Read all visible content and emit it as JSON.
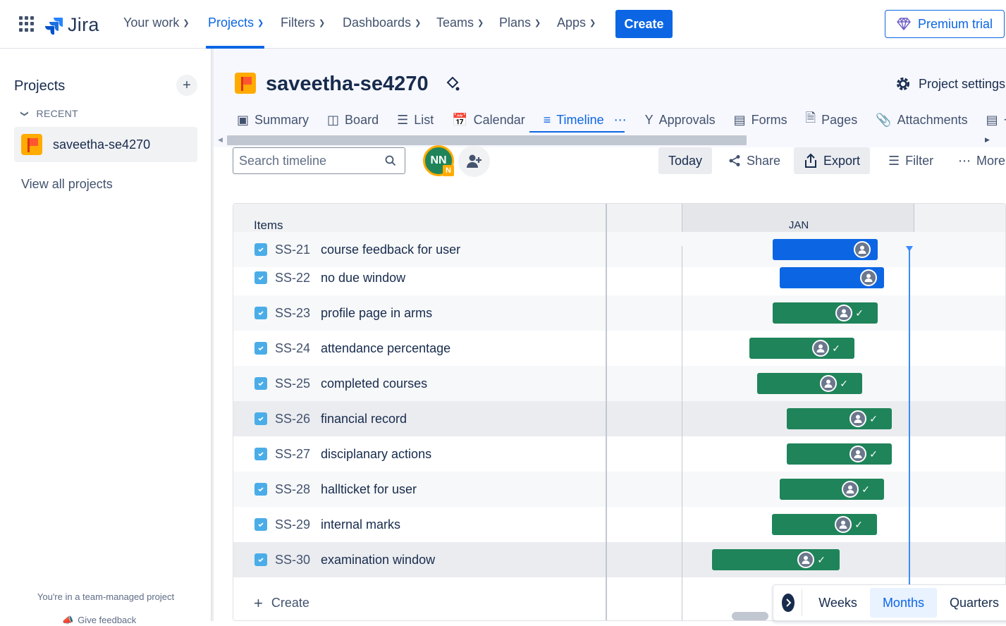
{
  "topnav": {
    "logo_text": "Jira",
    "items": [
      {
        "label": "Your work"
      },
      {
        "label": "Projects"
      },
      {
        "label": "Filters"
      },
      {
        "label": "Dashboards"
      },
      {
        "label": "Teams"
      },
      {
        "label": "Plans"
      },
      {
        "label": "Apps"
      }
    ],
    "active_item": "Projects",
    "create_label": "Create",
    "premium_label": "Premium trial",
    "accent": "#0c66e4"
  },
  "sidebar": {
    "title": "Projects",
    "recent_label": "RECENT",
    "project_name": "saveetha-se4270",
    "view_all": "View all projects",
    "footer_text": "You're in a team-managed project",
    "footer_link": "Give feedback"
  },
  "project": {
    "title": "saveetha-se4270",
    "settings_label": "Project settings",
    "tabs": [
      {
        "label": "Summary",
        "icon": "summary-icon"
      },
      {
        "label": "Board",
        "icon": "board-icon"
      },
      {
        "label": "List",
        "icon": "list-icon"
      },
      {
        "label": "Calendar",
        "icon": "calendar-icon"
      },
      {
        "label": "Timeline",
        "icon": "timeline-icon"
      },
      {
        "label": "Approvals",
        "icon": "approvals-icon"
      },
      {
        "label": "Forms",
        "icon": "forms-icon"
      },
      {
        "label": "Pages",
        "icon": "pages-icon"
      },
      {
        "label": "Attachments",
        "icon": "attachments-icon"
      }
    ],
    "active_tab": "Timeline"
  },
  "toolbar": {
    "search_placeholder": "Search timeline",
    "avatar_initials": "NN",
    "avatar_badge": "N",
    "today_label": "Today",
    "share_label": "Share",
    "export_label": "Export",
    "filter_label": "Filter",
    "more_label": "More"
  },
  "timeline": {
    "items_header": "Items",
    "month_label": "JAN",
    "create_label": "Create",
    "rows": [
      {
        "key": "SS-21",
        "summary": "course feedback for user",
        "status": "in-progress",
        "done": false
      },
      {
        "key": "SS-22",
        "summary": "no due window",
        "status": "in-progress",
        "done": false
      },
      {
        "key": "SS-23",
        "summary": "profile page in arms",
        "status": "done",
        "done": true
      },
      {
        "key": "SS-24",
        "summary": "attendance percentage",
        "status": "done",
        "done": true
      },
      {
        "key": "SS-25",
        "summary": "completed courses",
        "status": "done",
        "done": true
      },
      {
        "key": "SS-26",
        "summary": "financial record",
        "status": "done",
        "done": true
      },
      {
        "key": "SS-27",
        "summary": "disciplanary actions",
        "status": "done",
        "done": true
      },
      {
        "key": "SS-28",
        "summary": "hallticket for user",
        "status": "done",
        "done": true
      },
      {
        "key": "SS-29",
        "summary": "internal marks",
        "status": "done",
        "done": true
      },
      {
        "key": "SS-30",
        "summary": "examination window",
        "status": "done",
        "done": true
      }
    ],
    "zoom_options": [
      "Weeks",
      "Months",
      "Quarters"
    ],
    "active_zoom": "Months",
    "colors": {
      "in_progress": "#0c66e4",
      "done": "#1f845a",
      "today": "#388bff"
    }
  }
}
